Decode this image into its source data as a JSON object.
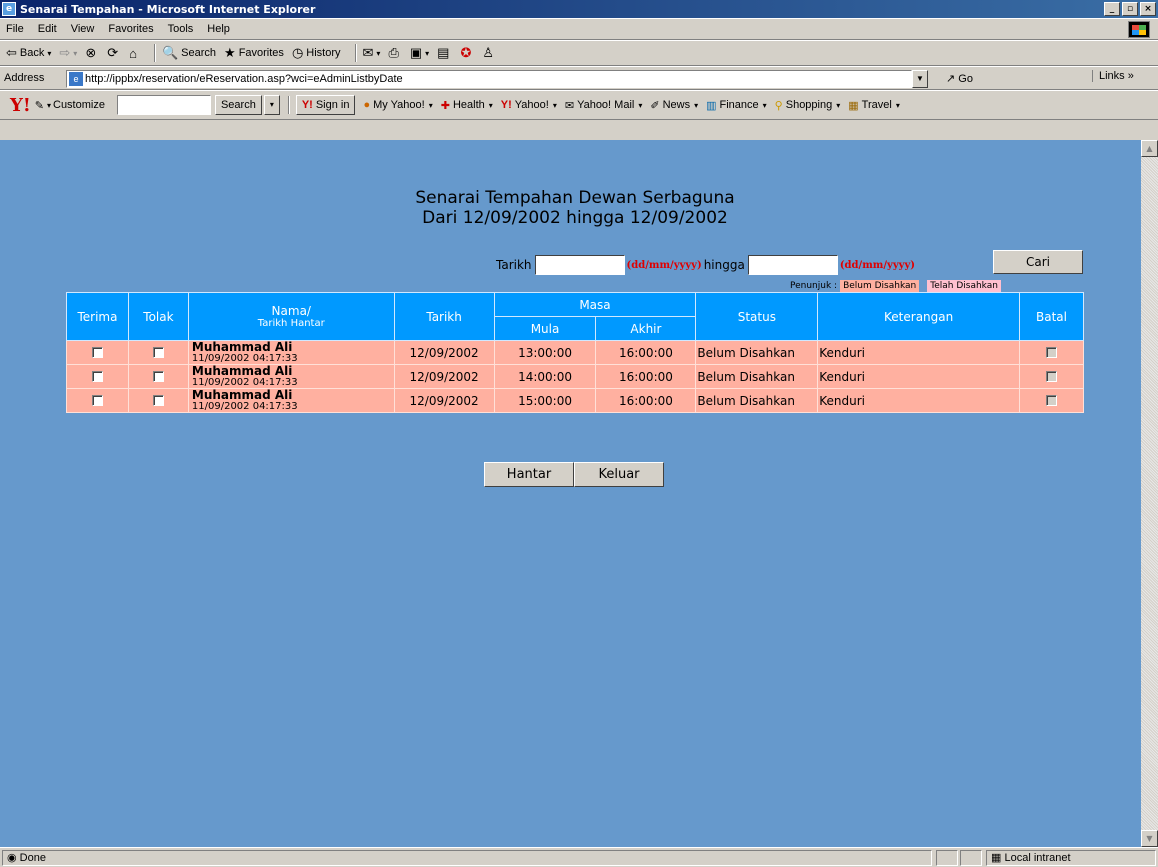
{
  "window": {
    "title": "Senarai Tempahan - Microsoft Internet Explorer"
  },
  "menu": [
    "File",
    "Edit",
    "View",
    "Favorites",
    "Tools",
    "Help"
  ],
  "toolbar": {
    "back": "Back",
    "search": "Search",
    "favorites": "Favorites",
    "history": "History"
  },
  "address": {
    "label": "Address",
    "url": "http://ippbx/reservation/eReservation.asp?wci=eAdminListbyDate",
    "go": "Go",
    "links": "Links"
  },
  "yahoo": {
    "customize": "Customize",
    "search_button": "Search",
    "items": [
      "Sign in",
      "My Yahoo!",
      "Health",
      "Yahoo!",
      "Yahoo! Mail",
      "News",
      "Finance",
      "Shopping",
      "Travel"
    ]
  },
  "page": {
    "title_line1": "Senarai Tempahan Dewan Serbaguna",
    "title_line2": "Dari 12/09/2002 hingga 12/09/2002"
  },
  "search": {
    "label_from": "Tarikh",
    "format": "(dd/mm/yyyy)",
    "label_to": "hingga",
    "button": "Cari",
    "from_value": "",
    "to_value": ""
  },
  "legend": {
    "prefix": "Penunjuk :",
    "belum": "Belum Disahkan",
    "telah": "Telah Disahkan"
  },
  "table": {
    "headers": {
      "terima": "Terima",
      "tolak": "Tolak",
      "nama": "Nama/",
      "nama_sub": "Tarikh Hantar",
      "tarikh": "Tarikh",
      "masa": "Masa",
      "mula": "Mula",
      "akhir": "Akhir",
      "status": "Status",
      "keterangan": "Keterangan",
      "batal": "Batal"
    },
    "rows": [
      {
        "nama": "Muhammad Ali",
        "hantar": "11/09/2002 04:17:33",
        "tarikh": "12/09/2002",
        "mula": "13:00:00",
        "akhir": "16:00:00",
        "status": "Belum Disahkan",
        "keterangan": "Kenduri"
      },
      {
        "nama": "Muhammad Ali",
        "hantar": "11/09/2002 04:17:33",
        "tarikh": "12/09/2002",
        "mula": "14:00:00",
        "akhir": "16:00:00",
        "status": "Belum Disahkan",
        "keterangan": "Kenduri"
      },
      {
        "nama": "Muhammad Ali",
        "hantar": "11/09/2002 04:17:33",
        "tarikh": "12/09/2002",
        "mula": "15:00:00",
        "akhir": "16:00:00",
        "status": "Belum Disahkan",
        "keterangan": "Kenduri"
      }
    ]
  },
  "actions": {
    "hantar": "Hantar",
    "keluar": "Keluar"
  },
  "status": {
    "text": "Done",
    "zone": "Local intranet"
  },
  "colors": {
    "background": "#6699cc",
    "header": "#0099ff",
    "row": "#ffb0a0",
    "format_red": "#e00000"
  }
}
